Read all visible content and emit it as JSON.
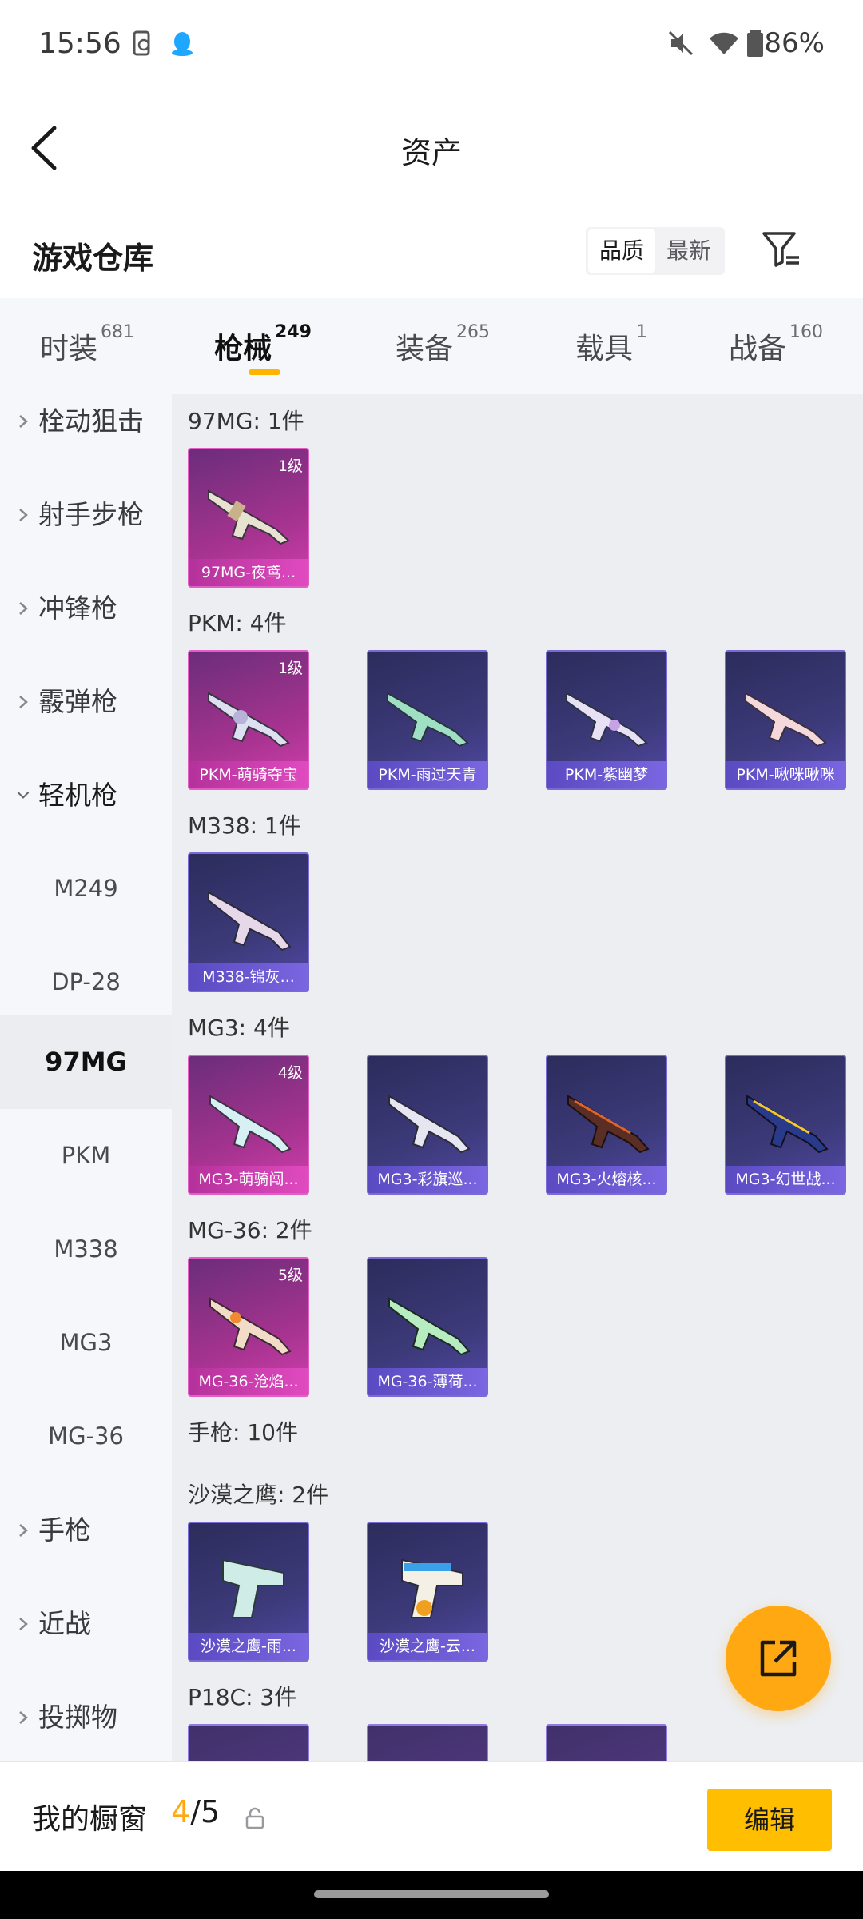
{
  "status_bar": {
    "time": "15:56",
    "battery": "86%"
  },
  "header": {
    "title": "资产"
  },
  "warehouse": {
    "title": "游戏仓库",
    "sort_options": [
      "品质",
      "最新"
    ],
    "sort_selected": "品质"
  },
  "tabs": [
    {
      "label": "时装",
      "count": "681"
    },
    {
      "label": "枪械",
      "count": "249",
      "active": true
    },
    {
      "label": "装备",
      "count": "265"
    },
    {
      "label": "载具",
      "count": "1"
    },
    {
      "label": "战备",
      "count": "160"
    }
  ],
  "sidebar": {
    "items": [
      {
        "label": "栓动狙击",
        "type": "category"
      },
      {
        "label": "射手步枪",
        "type": "category"
      },
      {
        "label": "冲锋枪",
        "type": "category"
      },
      {
        "label": "霰弹枪",
        "type": "category"
      },
      {
        "label": "轻机枪",
        "type": "category",
        "expanded": true
      },
      {
        "label": "M249",
        "type": "sub"
      },
      {
        "label": "DP-28",
        "type": "sub"
      },
      {
        "label": "97MG",
        "type": "sub",
        "active": true
      },
      {
        "label": "PKM",
        "type": "sub"
      },
      {
        "label": "M338",
        "type": "sub"
      },
      {
        "label": "MG3",
        "type": "sub"
      },
      {
        "label": "MG-36",
        "type": "sub"
      },
      {
        "label": "手枪",
        "type": "category"
      },
      {
        "label": "近战",
        "type": "category"
      },
      {
        "label": "投掷物",
        "type": "category"
      }
    ]
  },
  "groups": [
    {
      "title": "97MG: 1件",
      "items": [
        {
          "name": "97MG-夜鸢...",
          "level": "1级",
          "rarity": "pink"
        }
      ]
    },
    {
      "title": "PKM: 4件",
      "items": [
        {
          "name": "PKM-萌骑夺宝",
          "level": "1级",
          "rarity": "pink"
        },
        {
          "name": "PKM-雨过天青",
          "level": "",
          "rarity": "blue"
        },
        {
          "name": "PKM-紫幽梦",
          "level": "",
          "rarity": "blue"
        },
        {
          "name": "PKM-啾咪啾咪",
          "level": "",
          "rarity": "blue"
        }
      ]
    },
    {
      "title": "M338: 1件",
      "items": [
        {
          "name": "M338-锦灰...",
          "level": "",
          "rarity": "blue"
        }
      ]
    },
    {
      "title": "MG3: 4件",
      "items": [
        {
          "name": "MG3-萌骑闯...",
          "level": "4级",
          "rarity": "pink"
        },
        {
          "name": "MG3-彩旗巡...",
          "level": "",
          "rarity": "blue"
        },
        {
          "name": "MG3-火熔核...",
          "level": "",
          "rarity": "blue"
        },
        {
          "name": "MG3-幻世战...",
          "level": "",
          "rarity": "blue"
        }
      ]
    },
    {
      "title": "MG-36: 2件",
      "items": [
        {
          "name": "MG-36-沧焰...",
          "level": "5级",
          "rarity": "pink"
        },
        {
          "name": "MG-36-薄荷...",
          "level": "",
          "rarity": "blue"
        }
      ]
    }
  ],
  "pistol_section": {
    "title": "手枪: 10件"
  },
  "pistol_groups": [
    {
      "title": "沙漠之鹰: 2件",
      "items": [
        {
          "name": "沙漠之鹰-雨...",
          "rarity": "blue"
        },
        {
          "name": "沙漠之鹰-云...",
          "rarity": "blue"
        }
      ]
    },
    {
      "title": "P18C: 3件",
      "items": []
    }
  ],
  "bottom_bar": {
    "label": "我的橱窗",
    "current": "4",
    "total": "/5",
    "edit_label": "编辑"
  },
  "colors": {
    "accent": "#ffa812",
    "edit_button": "#ffbf00",
    "rare_pink": "#c93ab0",
    "rare_blue": "#5a4bc2"
  }
}
